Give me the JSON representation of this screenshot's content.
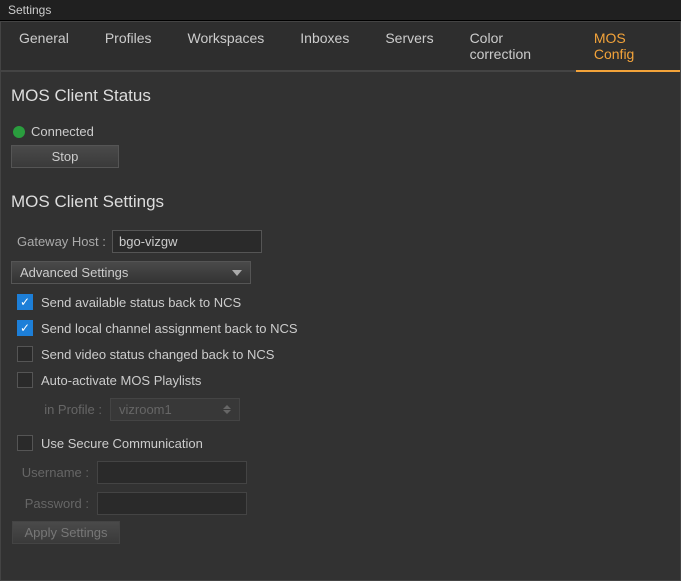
{
  "window": {
    "title": "Settings"
  },
  "tabs": [
    {
      "label": "General"
    },
    {
      "label": "Profiles"
    },
    {
      "label": "Workspaces"
    },
    {
      "label": "Inboxes"
    },
    {
      "label": "Servers"
    },
    {
      "label": "Color correction"
    },
    {
      "label": "MOS Config"
    }
  ],
  "status_section": {
    "heading": "MOS Client Status",
    "status_text": "Connected",
    "stop_button": "Stop"
  },
  "settings_section": {
    "heading": "MOS Client Settings",
    "gateway_label": "Gateway Host :",
    "gateway_value": "bgo-vizgw",
    "advanced_label": "Advanced Settings",
    "cb_status_label": "Send available status back to NCS",
    "cb_channel_label": "Send local channel assignment back to NCS",
    "cb_video_label": "Send video status changed back to NCS",
    "cb_autoactivate_label": "Auto-activate MOS Playlists",
    "in_profile_label": "in Profile :",
    "in_profile_value": "vizroom1",
    "cb_secure_label": "Use Secure Communication",
    "username_label": "Username :",
    "username_value": "",
    "password_label": "Password :",
    "password_value": "",
    "apply_button": "Apply Settings"
  }
}
